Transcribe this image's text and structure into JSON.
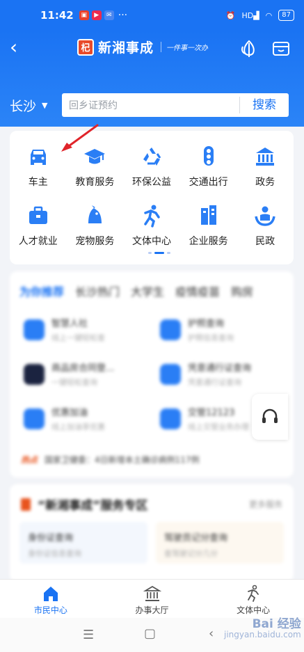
{
  "status_bar": {
    "time": "11:42",
    "dots": "···",
    "battery": "87",
    "network": "HD"
  },
  "header": {
    "logo_char": "杞",
    "app_name": "新湘事成",
    "slogan": "一件事一次办",
    "city": "长沙",
    "search_placeholder": "回乡证预约",
    "search_button": "搜索"
  },
  "service_grid": [
    {
      "label": "车主",
      "icon": "car-icon"
    },
    {
      "label": "教育服务",
      "icon": "graduation-cap-icon"
    },
    {
      "label": "环保公益",
      "icon": "recycle-icon"
    },
    {
      "label": "交通出行",
      "icon": "traffic-light-icon"
    },
    {
      "label": "政务",
      "icon": "government-building-icon"
    },
    {
      "label": "人才就业",
      "icon": "briefcase-icon"
    },
    {
      "label": "宠物服务",
      "icon": "pet-icon"
    },
    {
      "label": "文体中心",
      "icon": "runner-icon"
    },
    {
      "label": "企业服务",
      "icon": "office-building-icon"
    },
    {
      "label": "民政",
      "icon": "civil-affairs-icon"
    }
  ],
  "recommend": {
    "tabs": [
      "为你推荐",
      "长沙热门",
      "大学生",
      "疫情疫苗",
      "购房"
    ],
    "items": [
      {
        "title": "智慧人社",
        "sub": "线上一键轻松查"
      },
      {
        "title": "护照查询",
        "sub": "护照信息查询"
      },
      {
        "title": "商品房合同登...",
        "sub": "一键轻松查询"
      },
      {
        "title": "凭意通行证查询",
        "sub": "凭意通行证查询"
      },
      {
        "title": "优惠加油",
        "sub": "线上加油享优惠"
      },
      {
        "title": "交管12123",
        "sub": "线上交管业务办理"
      }
    ],
    "notice_tag": "热点",
    "notice_text": "国家卫健委：4日新增本土确诊病例117例"
  },
  "zone": {
    "title": "“新湘事成”服务专区",
    "more": "更多服务",
    "items": [
      {
        "title": "身份证查询",
        "sub": "身份证信息查询"
      },
      {
        "title": "驾驶员记分查询",
        "sub": "查驾驶记分几分"
      }
    ]
  },
  "tab_bar": [
    {
      "label": "市民中心",
      "icon": "home-icon",
      "active": true
    },
    {
      "label": "办事大厅",
      "icon": "hall-icon",
      "active": false
    },
    {
      "label": "文体中心",
      "icon": "runner-icon",
      "active": false
    }
  ],
  "watermark": {
    "line1": "Bai 经验",
    "line2": "jingyan.baidu.com"
  },
  "colors": {
    "primary": "#1a73f3",
    "notice": "#e8541e",
    "arrow": "#e0242a"
  }
}
